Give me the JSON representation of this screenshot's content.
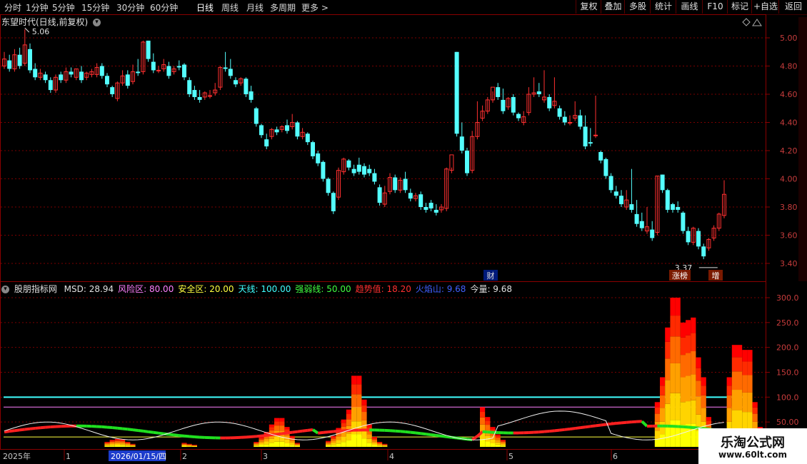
{
  "toolbar": {
    "periods": [
      "分时",
      "1分钟",
      "5分钟",
      "15分钟",
      "30分钟",
      "60分钟",
      "日线",
      "周线",
      "月线",
      "多周期",
      "更多"
    ],
    "active_period": "日线",
    "right_buttons": [
      "复权",
      "叠加",
      "多股",
      "统计",
      "画线",
      "F10",
      "标记",
      "+自选",
      "返回"
    ]
  },
  "main_panel": {
    "stock_title": "东望时代(日线,前复权)",
    "high_label": "5.06",
    "low_label": "3.37",
    "marker_cai": "财",
    "marker_zhangbang": "涨榜",
    "marker_zeng": "增",
    "y_ticks": [
      "5.00",
      "4.80",
      "4.60",
      "4.40",
      "4.20",
      "4.00",
      "3.80",
      "3.60",
      "3.40"
    ],
    "y_values": [
      5.0,
      4.8,
      4.6,
      4.4,
      4.2,
      4.0,
      3.8,
      3.6,
      3.4
    ]
  },
  "indicator_panel": {
    "name": "股朋指标网",
    "params": [
      {
        "label": "MSD:",
        "value": "28.94",
        "color": "#ffffff"
      },
      {
        "label": "风险区:",
        "value": "80.00",
        "color": "#ff80ff"
      },
      {
        "label": "安全区:",
        "value": "20.00",
        "color": "#ffff40"
      },
      {
        "label": "天线:",
        "value": "100.00",
        "color": "#40ffff"
      },
      {
        "label": "强弱线:",
        "value": "50.00",
        "color": "#40ff40"
      },
      {
        "label": "趋势值:",
        "value": "18.20",
        "color": "#ff3030"
      },
      {
        "label": "火焰山:",
        "value": "9.68",
        "color": "#4060ff"
      },
      {
        "label": "今量:",
        "value": "9.68",
        "color": "#ffffff"
      }
    ],
    "y_ticks": [
      "300.0",
      "250.0",
      "200.0",
      "150.0",
      "100.0",
      "50.00"
    ],
    "y_values": [
      300,
      250,
      200,
      150,
      100,
      50
    ],
    "levels": {
      "antenna": 100,
      "risk": 80,
      "safe": 20
    }
  },
  "date_axis": {
    "year_label": "2025年",
    "month_labels": [
      "1",
      "2",
      "3",
      "4",
      "5",
      "6"
    ],
    "cursor_date": "2026/01/15/四"
  },
  "watermark": {
    "title": "乐淘公式网",
    "url": "www.60lt.com"
  },
  "colors": {
    "up": "#ff3030",
    "down": "#54ffff",
    "grid": "#7a0000",
    "axis_text": "#c83c3c"
  },
  "chart_data": [
    {
      "type": "candlestick",
      "title": "东望时代(日线,前复权)",
      "ylim": [
        3.33,
        5.1
      ],
      "high": 5.06,
      "low": 3.37,
      "candles": [
        {
          "o": 4.8,
          "h": 4.9,
          "c": 4.85
        },
        {
          "o": 4.84,
          "h": 4.88,
          "c": 4.78
        },
        {
          "o": 4.78,
          "h": 4.92,
          "c": 4.88
        },
        {
          "o": 4.88,
          "h": 4.93,
          "c": 4.8
        },
        {
          "o": 4.82,
          "h": 5.06,
          "c": 4.95
        },
        {
          "o": 4.92,
          "h": 4.96,
          "c": 4.77
        },
        {
          "o": 4.78,
          "h": 4.82,
          "c": 4.72
        },
        {
          "o": 4.72,
          "h": 4.78,
          "c": 4.75
        },
        {
          "o": 4.74,
          "h": 4.76,
          "c": 4.7
        },
        {
          "o": 4.7,
          "h": 4.72,
          "c": 4.63
        },
        {
          "o": 4.63,
          "h": 4.74,
          "c": 4.72
        },
        {
          "o": 4.74,
          "h": 4.76,
          "c": 4.7
        },
        {
          "o": 4.7,
          "h": 4.79,
          "c": 4.76
        },
        {
          "o": 4.76,
          "h": 4.79,
          "c": 4.74
        },
        {
          "o": 4.72,
          "h": 4.78,
          "c": 4.78
        },
        {
          "o": 4.76,
          "h": 4.8,
          "c": 4.7
        },
        {
          "o": 4.72,
          "h": 4.76,
          "c": 4.75
        },
        {
          "o": 4.74,
          "h": 4.78,
          "c": 4.76
        },
        {
          "o": 4.74,
          "h": 4.82,
          "c": 4.79
        },
        {
          "o": 4.8,
          "h": 4.82,
          "c": 4.73
        },
        {
          "o": 4.73,
          "h": 4.75,
          "c": 4.67
        },
        {
          "o": 4.65,
          "h": 4.66,
          "c": 4.6
        },
        {
          "o": 4.57,
          "h": 4.69,
          "c": 4.68
        },
        {
          "o": 4.68,
          "h": 4.77,
          "c": 4.73
        },
        {
          "o": 4.74,
          "h": 4.77,
          "c": 4.66
        },
        {
          "o": 4.69,
          "h": 4.81,
          "c": 4.76
        },
        {
          "o": 4.76,
          "h": 4.85,
          "c": 4.75
        },
        {
          "o": 4.76,
          "h": 4.98,
          "c": 4.97
        },
        {
          "o": 4.98,
          "h": 4.98,
          "c": 4.85
        },
        {
          "o": 4.83,
          "h": 4.89,
          "c": 4.77
        },
        {
          "o": 4.77,
          "h": 4.8,
          "c": 4.77
        },
        {
          "o": 4.78,
          "h": 4.85,
          "c": 4.81
        },
        {
          "o": 4.8,
          "h": 4.83,
          "c": 4.73
        },
        {
          "o": 4.76,
          "h": 4.8,
          "c": 4.78
        },
        {
          "o": 4.8,
          "h": 4.84,
          "c": 4.79
        },
        {
          "o": 4.81,
          "h": 4.82,
          "c": 4.72
        },
        {
          "o": 4.7,
          "h": 4.72,
          "c": 4.6
        },
        {
          "o": 4.63,
          "h": 4.66,
          "c": 4.58
        },
        {
          "o": 4.58,
          "h": 4.63,
          "c": 4.56
        },
        {
          "o": 4.58,
          "h": 4.62,
          "c": 4.61
        },
        {
          "o": 4.59,
          "h": 4.63,
          "c": 4.59
        },
        {
          "o": 4.61,
          "h": 4.68,
          "c": 4.63
        },
        {
          "o": 4.65,
          "h": 4.8,
          "c": 4.79
        },
        {
          "o": 4.79,
          "h": 4.9,
          "c": 4.78
        },
        {
          "o": 4.78,
          "h": 4.85,
          "c": 4.73
        },
        {
          "o": 4.7,
          "h": 4.72,
          "c": 4.67
        },
        {
          "o": 4.68,
          "h": 4.72,
          "c": 4.71
        },
        {
          "o": 4.71,
          "h": 4.72,
          "c": 4.6
        },
        {
          "o": 4.62,
          "h": 4.66,
          "c": 4.56
        },
        {
          "o": 4.5,
          "h": 4.51,
          "c": 4.39
        },
        {
          "o": 4.38,
          "h": 4.39,
          "c": 4.31
        },
        {
          "o": 4.28,
          "h": 4.32,
          "c": 4.23
        },
        {
          "o": 4.3,
          "h": 4.36,
          "c": 4.35
        },
        {
          "o": 4.35,
          "h": 4.37,
          "c": 4.33
        },
        {
          "o": 4.35,
          "h": 4.38,
          "c": 4.37
        },
        {
          "o": 4.38,
          "h": 4.42,
          "c": 4.34
        },
        {
          "o": 4.37,
          "h": 4.46,
          "c": 4.4
        },
        {
          "o": 4.4,
          "h": 4.41,
          "c": 4.3
        },
        {
          "o": 4.3,
          "h": 4.36,
          "c": 4.33
        },
        {
          "o": 4.32,
          "h": 4.33,
          "c": 4.26
        },
        {
          "o": 4.26,
          "h": 4.27,
          "c": 4.16
        },
        {
          "o": 4.18,
          "h": 4.2,
          "c": 4.11
        },
        {
          "o": 4.12,
          "h": 4.13,
          "c": 4.0
        },
        {
          "o": 4.0,
          "h": 4.01,
          "c": 3.9
        },
        {
          "o": 3.9,
          "h": 3.91,
          "c": 3.77
        },
        {
          "o": 3.87,
          "h": 4.08,
          "c": 4.06
        },
        {
          "o": 4.05,
          "h": 4.15,
          "c": 4.14
        },
        {
          "o": 4.13,
          "h": 4.14,
          "c": 4.08
        },
        {
          "o": 4.07,
          "h": 4.1,
          "c": 4.04
        },
        {
          "o": 4.1,
          "h": 4.15,
          "c": 4.05
        },
        {
          "o": 4.09,
          "h": 4.11,
          "c": 4.03
        },
        {
          "o": 4.07,
          "h": 4.1,
          "c": 4.04
        },
        {
          "o": 4.04,
          "h": 4.07,
          "c": 3.98
        },
        {
          "o": 3.94,
          "h": 3.96,
          "c": 3.83
        },
        {
          "o": 3.82,
          "h": 3.95,
          "c": 3.9
        },
        {
          "o": 3.91,
          "h": 4.04,
          "c": 4.01
        },
        {
          "o": 4.01,
          "h": 4.03,
          "c": 3.92
        },
        {
          "o": 3.92,
          "h": 4.01,
          "c": 3.99
        },
        {
          "o": 4.0,
          "h": 4.05,
          "c": 3.92
        },
        {
          "o": 3.9,
          "h": 3.93,
          "c": 3.86
        },
        {
          "o": 3.86,
          "h": 3.9,
          "c": 3.88
        },
        {
          "o": 3.89,
          "h": 3.91,
          "c": 3.8
        },
        {
          "o": 3.8,
          "h": 3.83,
          "c": 3.78
        },
        {
          "o": 3.83,
          "h": 3.85,
          "c": 3.79
        },
        {
          "o": 3.78,
          "h": 3.82,
          "c": 3.76
        },
        {
          "o": 3.78,
          "h": 3.82,
          "c": 3.8
        },
        {
          "o": 3.79,
          "h": 4.08,
          "c": 4.07
        },
        {
          "o": 4.06,
          "h": 4.08,
          "c": 4.17
        },
        {
          "o": 4.9,
          "h": 4.9,
          "c": 4.32
        },
        {
          "o": 4.3,
          "h": 4.4,
          "c": 4.2
        },
        {
          "o": 4.2,
          "h": 4.22,
          "c": 4.04
        },
        {
          "o": 4.06,
          "h": 4.34,
          "c": 4.3
        },
        {
          "o": 4.3,
          "h": 4.55,
          "c": 4.4
        },
        {
          "o": 4.43,
          "h": 4.52,
          "c": 4.48
        },
        {
          "o": 4.48,
          "h": 4.58,
          "c": 4.56
        },
        {
          "o": 4.56,
          "h": 4.62,
          "c": 4.65
        },
        {
          "o": 4.65,
          "h": 4.68,
          "c": 4.58
        },
        {
          "o": 4.56,
          "h": 4.64,
          "c": 4.48
        },
        {
          "o": 4.51,
          "h": 4.58,
          "c": 4.57
        },
        {
          "o": 4.58,
          "h": 4.6,
          "c": 4.47
        },
        {
          "o": 4.46,
          "h": 4.47,
          "c": 4.43
        },
        {
          "o": 4.4,
          "h": 4.48,
          "c": 4.44
        },
        {
          "o": 4.47,
          "h": 4.65,
          "c": 4.6
        },
        {
          "o": 4.6,
          "h": 4.72,
          "c": 4.61
        },
        {
          "o": 4.62,
          "h": 4.68,
          "c": 4.6
        },
        {
          "o": 4.56,
          "h": 4.77,
          "c": 4.58
        },
        {
          "o": 4.58,
          "h": 4.6,
          "c": 4.5
        },
        {
          "o": 4.52,
          "h": 4.72,
          "c": 4.55
        },
        {
          "o": 4.5,
          "h": 4.52,
          "c": 4.44
        },
        {
          "o": 4.44,
          "h": 4.48,
          "c": 4.4
        },
        {
          "o": 4.4,
          "h": 4.45,
          "c": 4.4
        },
        {
          "o": 4.43,
          "h": 4.55,
          "c": 4.45
        },
        {
          "o": 4.45,
          "h": 4.49,
          "c": 4.37
        },
        {
          "o": 4.37,
          "h": 4.45,
          "c": 4.23
        },
        {
          "o": 4.26,
          "h": 4.36,
          "c": 4.25
        },
        {
          "o": 4.31,
          "h": 4.59,
          "c": 4.31
        },
        {
          "o": 4.19,
          "h": 4.2,
          "c": 4.13
        },
        {
          "o": 4.14,
          "h": 4.15,
          "c": 4.02
        },
        {
          "o": 4.02,
          "h": 4.04,
          "c": 3.92
        },
        {
          "o": 3.91,
          "h": 3.95,
          "c": 3.88
        },
        {
          "o": 3.88,
          "h": 3.92,
          "c": 3.82
        },
        {
          "o": 3.8,
          "h": 3.92,
          "c": 3.85
        },
        {
          "o": 3.82,
          "h": 4.07,
          "c": 3.78
        },
        {
          "o": 3.75,
          "h": 3.85,
          "c": 3.68
        },
        {
          "o": 3.7,
          "h": 3.76,
          "c": 3.65
        },
        {
          "o": 3.63,
          "h": 3.8,
          "c": 3.66
        },
        {
          "o": 3.64,
          "h": 3.7,
          "c": 3.58
        },
        {
          "o": 3.62,
          "h": 4.02,
          "c": 4.02
        },
        {
          "o": 4.03,
          "h": 4.03,
          "c": 3.92
        },
        {
          "o": 3.92,
          "h": 3.93,
          "c": 3.78
        },
        {
          "o": 3.82,
          "h": 3.83,
          "c": 3.78
        },
        {
          "o": 3.8,
          "h": 3.84,
          "c": 3.78
        },
        {
          "o": 3.76,
          "h": 3.77,
          "c": 3.63
        },
        {
          "o": 3.63,
          "h": 3.66,
          "c": 3.55
        },
        {
          "o": 3.55,
          "h": 3.66,
          "c": 3.65
        },
        {
          "o": 3.63,
          "h": 3.65,
          "c": 3.52
        },
        {
          "o": 3.52,
          "h": 3.54,
          "c": 3.45
        },
        {
          "o": 3.51,
          "h": 3.58,
          "c": 3.57
        },
        {
          "o": 3.58,
          "h": 3.67,
          "c": 3.65
        },
        {
          "o": 3.65,
          "h": 3.76,
          "c": 3.75
        },
        {
          "o": 3.74,
          "h": 3.99,
          "c": 3.89
        }
      ]
    },
    {
      "type": "bar",
      "title": "股朋指标网",
      "ylim": [
        0,
        330
      ],
      "series": [
        {
          "name": "火焰山",
          "values": [
            0,
            0,
            0,
            0,
            0,
            0,
            0,
            0,
            0,
            0,
            0,
            0,
            0,
            0,
            0,
            0,
            0,
            0,
            0,
            0,
            0,
            0,
            0,
            0,
            0,
            0,
            0,
            0,
            0,
            0,
            0,
            0,
            0,
            0,
            0,
            0,
            0,
            0,
            0,
            0,
            0,
            0,
            0,
            0,
            0,
            0,
            0,
            0,
            0,
            0,
            0,
            0,
            0,
            0,
            0,
            0,
            0,
            0,
            0,
            0,
            0,
            0,
            0,
            0,
            0,
            0,
            0,
            0,
            0,
            0,
            0,
            0,
            0,
            0,
            0,
            0,
            0,
            0,
            0,
            0,
            0,
            0,
            0,
            0,
            0,
            0,
            0,
            0,
            0,
            0,
            0,
            0,
            0,
            0,
            0,
            0,
            0,
            0,
            0,
            0,
            0,
            0,
            0,
            0,
            0,
            0,
            0,
            0,
            0,
            0,
            0,
            0,
            0,
            0,
            0,
            0,
            0,
            0,
            0,
            0,
            0,
            0,
            0,
            0,
            0,
            0,
            0,
            0,
            0,
            0,
            0,
            0,
            0,
            0,
            0,
            0,
            0,
            0,
            0,
            0,
            0,
            0,
            0,
            0,
            0,
            0,
            0
          ]
        }
      ],
      "clusters": [
        {
          "from": 8,
          "heights": [
            0
          ]
        },
        {
          "start": 20,
          "heights": [
            10,
            14,
            16,
            15,
            10,
            6
          ]
        },
        {
          "start": 35,
          "heights": [
            8,
            6,
            4
          ]
        },
        {
          "start": 49,
          "heights": [
            10,
            20,
            30,
            45,
            58,
            58,
            40,
            22,
            8
          ]
        },
        {
          "start": 63,
          "heights": [
            12,
            22,
            38,
            55,
            75,
            143,
            143,
            95,
            45,
            20,
            10,
            6
          ]
        },
        {
          "start": 93,
          "heights": [
            80,
            60,
            40,
            25,
            14
          ]
        },
        {
          "start": 127,
          "heights": [
            90,
            140,
            240,
            300,
            300,
            250,
            255,
            260,
            180,
            140,
            60,
            25,
            10
          ]
        },
        {
          "start": 141,
          "heights": [
            140,
            205,
            205,
            195,
            195,
            90,
            40
          ]
        }
      ],
      "levels": [
        {
          "name": "天线",
          "value": 100
        },
        {
          "name": "风险区",
          "value": 80
        },
        {
          "name": "安全区",
          "value": 20
        }
      ]
    }
  ]
}
